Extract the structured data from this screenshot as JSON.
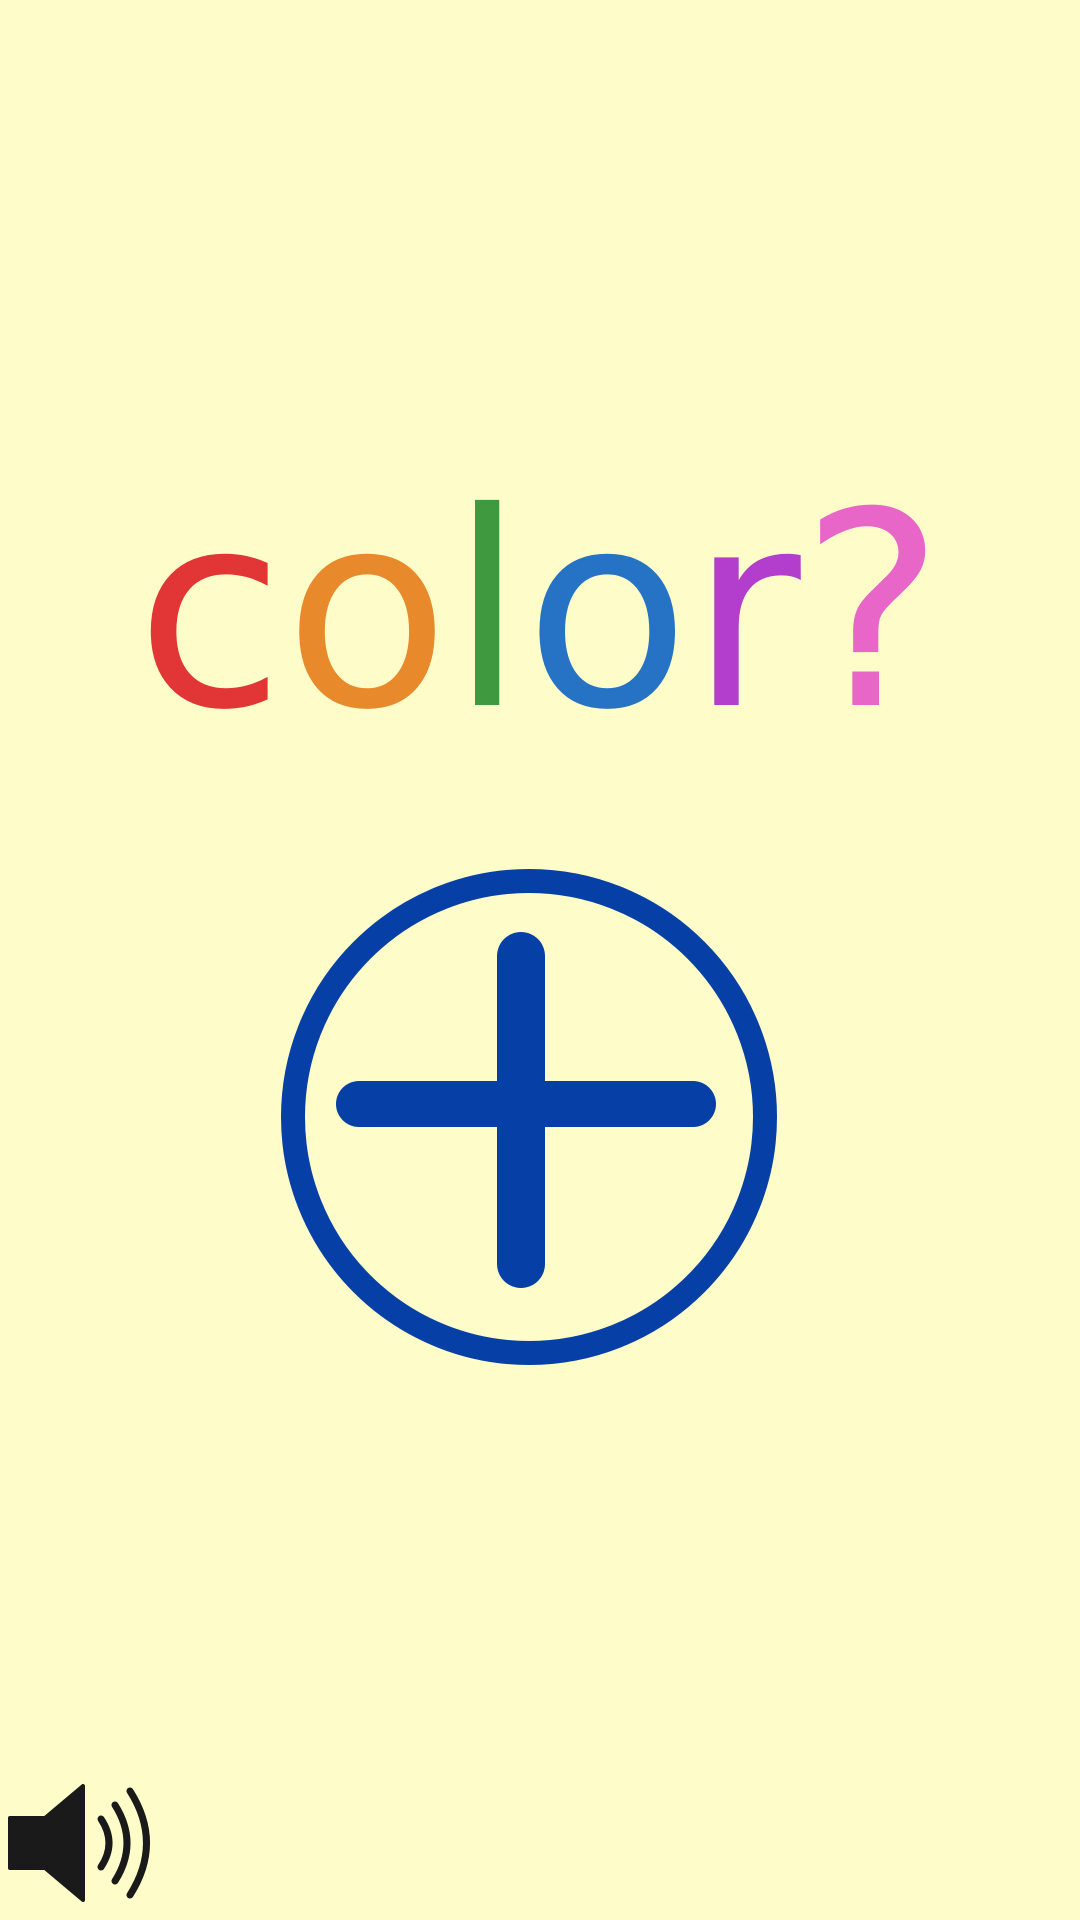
{
  "title": {
    "letters": [
      {
        "char": "c",
        "color": "#e23535"
      },
      {
        "char": "o",
        "color": "#e8892c"
      },
      {
        "char": "l",
        "color": "#3f9a3f"
      },
      {
        "char": "o",
        "color": "#2673c6"
      },
      {
        "char": "r",
        "color": "#b33dcc"
      },
      {
        "char": "?",
        "color": "#e866c8"
      }
    ]
  },
  "colors": {
    "background": "#fefdca",
    "accent": "#063fa6",
    "sound_icon": "#1a1a1a"
  },
  "icons": {
    "add": "plus-circle-icon",
    "sound": "speaker-volume-icon"
  }
}
